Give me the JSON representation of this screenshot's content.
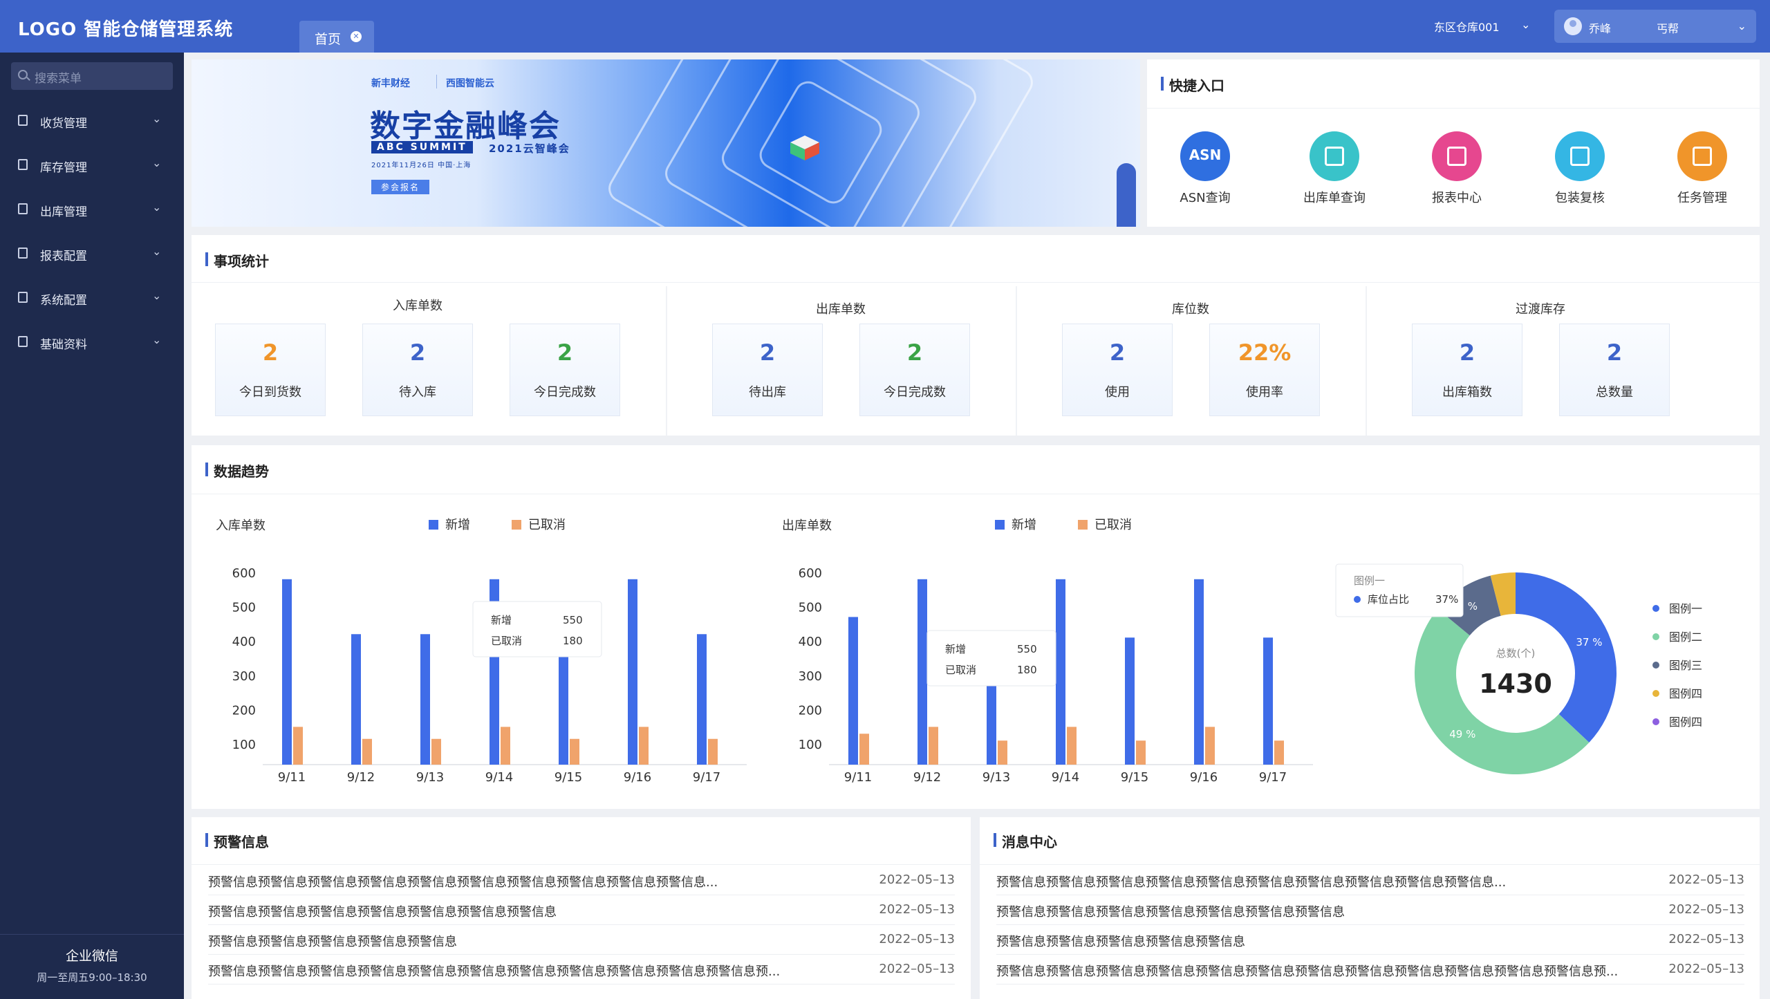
{
  "header": {
    "logo": "LOGO  智能仓储管理系统",
    "tab_home": "首页",
    "warehouse": "东区仓库001",
    "user_name": "乔峰",
    "user_help": "丐帮"
  },
  "sidebar": {
    "search_placeholder": "搜索菜单",
    "items": [
      {
        "label": "收货管理"
      },
      {
        "label": "库存管理"
      },
      {
        "label": "出库管理"
      },
      {
        "label": "报表配置"
      },
      {
        "label": "系统配置"
      },
      {
        "label": "基础资料"
      }
    ],
    "footer_title": "企业微信",
    "footer_hours": "周一至周五9:00–18:30"
  },
  "banner": {
    "brand1": "新丰财经",
    "brand2": "西图智能云",
    "headline": "数字金融峰会",
    "tag": "ABC SUMMIT",
    "tag2": "2021云智峰会",
    "date": "2021年11月26日   中国·上海",
    "signup": "参会报名"
  },
  "quick": {
    "title": "快捷入口",
    "items": [
      {
        "label": "ASN查询",
        "icon": "asn-icon",
        "color": "#2f6fe0"
      },
      {
        "label": "出库单查询",
        "icon": "outbound-query-icon",
        "color": "#39c3c9"
      },
      {
        "label": "报表中心",
        "icon": "report-chart-icon",
        "color": "#e6478f"
      },
      {
        "label": "包装复核",
        "icon": "package-check-icon",
        "color": "#34b6e4"
      },
      {
        "label": "任务管理",
        "icon": "task-list-icon",
        "color": "#f0952a"
      }
    ],
    "asn_text": "ASN"
  },
  "stats": {
    "title": "事项统计",
    "groups": [
      {
        "title": "入库单数",
        "items": [
          {
            "value": "2",
            "label": "今日到货数",
            "color": "#f0952a"
          },
          {
            "value": "2",
            "label": "待入库",
            "color": "#3d63c9"
          },
          {
            "value": "2",
            "label": "今日完成数",
            "color": "#3aa346"
          }
        ]
      },
      {
        "title": "出库单数",
        "items": [
          {
            "value": "2",
            "label": "待出库",
            "color": "#3d63c9"
          },
          {
            "value": "2",
            "label": "今日完成数",
            "color": "#3aa346"
          }
        ]
      },
      {
        "title": "库位数",
        "items": [
          {
            "value": "2",
            "label": "使用",
            "color": "#3d63c9"
          },
          {
            "value": "22%",
            "label": "使用率",
            "color": "#f0952a"
          }
        ]
      },
      {
        "title": "过渡库存",
        "items": [
          {
            "value": "2",
            "label": "出库箱数",
            "color": "#3d63c9"
          },
          {
            "value": "2",
            "label": "总数量",
            "color": "#3d63c9"
          }
        ]
      }
    ]
  },
  "trend": {
    "title": "数据趋势"
  },
  "chart_data": [
    {
      "type": "bar",
      "ylabel": "入库单数",
      "categories": [
        "9/11",
        "9/12",
        "9/13",
        "9/14",
        "9/15",
        "9/16",
        "9/17"
      ],
      "yticks": [
        100,
        200,
        300,
        400,
        500,
        600
      ],
      "ylim": [
        40,
        640
      ],
      "legend": "top",
      "series": [
        {
          "name": "新增",
          "color": "#3f6ce8",
          "values": [
            580,
            420,
            420,
            580,
            420,
            580,
            420
          ]
        },
        {
          "name": "已取消",
          "color": "#f0a36b",
          "values": [
            150,
            115,
            115,
            150,
            115,
            150,
            115
          ]
        }
      ],
      "tooltip": {
        "rows": [
          [
            "新增",
            "550"
          ],
          [
            "已取消",
            "180"
          ]
        ]
      }
    },
    {
      "type": "bar",
      "ylabel": "出库单数",
      "categories": [
        "9/11",
        "9/12",
        "9/13",
        "9/14",
        "9/15",
        "9/16",
        "9/17"
      ],
      "yticks": [
        100,
        200,
        300,
        400,
        500,
        600
      ],
      "ylim": [
        40,
        640
      ],
      "legend": "top",
      "series": [
        {
          "name": "新增",
          "color": "#3f6ce8",
          "values": [
            470,
            580,
            420,
            580,
            410,
            580,
            410
          ]
        },
        {
          "name": "已取消",
          "color": "#f0a36b",
          "values": [
            130,
            150,
            110,
            150,
            110,
            150,
            110
          ]
        }
      ],
      "tooltip": {
        "rows": [
          [
            "新增",
            "550"
          ],
          [
            "已取消",
            "180"
          ]
        ]
      }
    },
    {
      "type": "pie",
      "center_label": "总数(个)",
      "center_value": "1430",
      "legend": "right",
      "slices": [
        {
          "name": "图例一",
          "value": 37,
          "label": "37 %",
          "color": "#3f6ce8"
        },
        {
          "name": "图例二",
          "value": 49,
          "label": "49 %",
          "color": "#7fd3a6"
        },
        {
          "name": "图例三",
          "value": 10,
          "label": "%",
          "color": "#5b6b8c"
        },
        {
          "name": "图例四",
          "value": 4,
          "label": "",
          "color": "#e8b53a"
        },
        {
          "name": "图例四",
          "value": 0,
          "label": "",
          "color": "#8d5fe0"
        }
      ],
      "tooltip": {
        "title": "图例一",
        "name": "库位占比",
        "value": "37%"
      }
    }
  ],
  "alerts": {
    "title": "预警信息",
    "rows": [
      {
        "text": "预警信息预警信息预警信息预警信息预警信息预警信息预警信息预警信息预警信息预警信息...",
        "date": "2022–05–13"
      },
      {
        "text": "预警信息预警信息预警信息预警信息预警信息预警信息预警信息",
        "date": "2022–05–13"
      },
      {
        "text": "预警信息预警信息预警信息预警信息预警信息",
        "date": "2022–05–13"
      },
      {
        "text": "预警信息预警信息预警信息预警信息预警信息预警信息预警信息预警信息预警信息预警信息预警信息预...",
        "date": "2022–05–13"
      }
    ]
  },
  "messages": {
    "title": "消息中心",
    "rows": [
      {
        "text": "预警信息预警信息预警信息预警信息预警信息预警信息预警信息预警信息预警信息预警信息...",
        "date": "2022–05–13"
      },
      {
        "text": "预警信息预警信息预警信息预警信息预警信息预警信息预警信息",
        "date": "2022–05–13"
      },
      {
        "text": "预警信息预警信息预警信息预警信息预警信息",
        "date": "2022–05–13"
      },
      {
        "text": "预警信息预警信息预警信息预警信息预警信息预警信息预警信息预警信息预警信息预警信息预警信息预警信息预...",
        "date": "2022–05–13"
      }
    ]
  }
}
